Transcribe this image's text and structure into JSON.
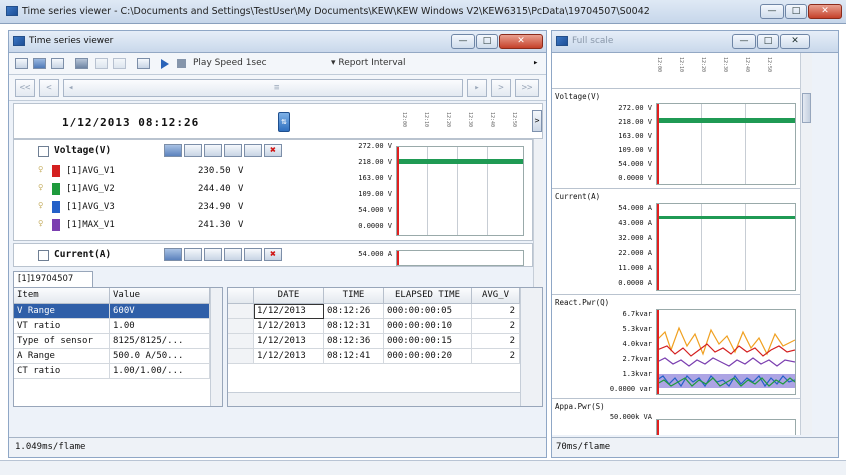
{
  "outer_window": {
    "title": "Time series viewer - C:\\Documents and Settings\\TestUser\\My Documents\\KEW\\KEW Windows V2\\KEW6315\\PcData\\19704507\\S0042",
    "buttons": {
      "minimize": "—",
      "maximize": "□",
      "close": "✕"
    }
  },
  "left_window": {
    "title": "Time series viewer",
    "buttons": {
      "minimize": "—",
      "maximize": "□",
      "close": "✕"
    },
    "toolbar": {
      "play_speed": "Play Speed 1sec",
      "report_interval": "Report Interval",
      "more": "▸"
    },
    "nav": {
      "first": "<<",
      "prev": "<",
      "scroll_left": "◂",
      "scroll_thumb": "≡",
      "scroll_right": "▸",
      "next": ">",
      "last": ">>"
    },
    "datetime": "1/12/2013 08:12:26",
    "header_times": [
      "12:00",
      "12:10",
      "12:20",
      "12:30",
      "12:40",
      "12:50"
    ],
    "voltage": {
      "title": "Voltage(V)",
      "rows": [
        {
          "name": "[1]AVG_V1",
          "value": "230.50",
          "unit": "V",
          "color": "#d42020"
        },
        {
          "name": "[1]AVG_V2",
          "value": "244.40",
          "unit": "V",
          "color": "#1e9a3c"
        },
        {
          "name": "[1]AVG_V3",
          "value": "234.90",
          "unit": "V",
          "color": "#2460c8"
        },
        {
          "name": "[1]MAX_V1",
          "value": "241.30",
          "unit": "V",
          "color": "#7b3fb0"
        }
      ],
      "axis": [
        "272.00 V",
        "218.00 V",
        "163.00 V",
        "109.00 V",
        "54.000 V",
        "0.0000 V"
      ]
    },
    "current": {
      "title": "Current(A)",
      "axis": [
        "54.000 A"
      ]
    },
    "tab": "[1]19704507",
    "props": {
      "headers": [
        "Item",
        "Value"
      ],
      "rows": [
        [
          "V Range",
          "600V"
        ],
        [
          "VT ratio",
          "1.00"
        ],
        [
          "Type of sensor",
          "8125/8125/..."
        ],
        [
          "A Range",
          "500.0 A/50..."
        ],
        [
          "CT ratio",
          "1.00/1.00/..."
        ]
      ]
    },
    "table": {
      "headers": [
        "DATE",
        "TIME",
        "ELAPSED TIME",
        "AVG_V"
      ],
      "rows": [
        [
          "1/12/2013",
          "08:12:26",
          "000:00:00:05",
          "2"
        ],
        [
          "1/12/2013",
          "08:12:31",
          "000:00:00:10",
          "2"
        ],
        [
          "1/12/2013",
          "08:12:36",
          "000:00:00:15",
          "2"
        ],
        [
          "1/12/2013",
          "08:12:41",
          "000:00:00:20",
          "2"
        ]
      ]
    },
    "status": "1.049ms/flame"
  },
  "right_window": {
    "title": "Full scale",
    "buttons": {
      "minimize": "—",
      "maximize": "□",
      "close": "✕"
    },
    "header_times": [
      "12:00",
      "12:10",
      "12:20",
      "12:30",
      "12:40",
      "12:50"
    ],
    "panels": [
      {
        "title": "Voltage(V)",
        "axis": [
          "272.00 V",
          "218.00 V",
          "163.00 V",
          "109.00 V",
          "54.000 V",
          "0.0000 V"
        ]
      },
      {
        "title": "Current(A)",
        "axis": [
          "54.000 A",
          "43.000 A",
          "32.000 A",
          "22.000 A",
          "11.000 A",
          "0.0000 A"
        ]
      },
      {
        "title": "React.Pwr(Q)",
        "axis": [
          "6.7kvar",
          "5.3kvar",
          "4.0kvar",
          "2.7kvar",
          "1.3kvar",
          "0.0000 var"
        ]
      },
      {
        "title": "Appa.Pwr(S)",
        "axis": [
          "50.000k VA"
        ]
      }
    ],
    "status": "70ms/flame"
  },
  "colors": {
    "red_line": "#e02020",
    "green_band": "#1f9a54",
    "selection": "#2f5fa8"
  }
}
